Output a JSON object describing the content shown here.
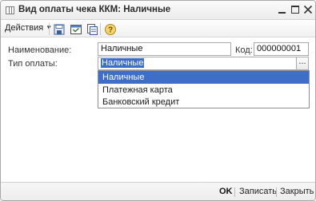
{
  "window": {
    "title": "Вид оплаты чека ККМ: Наличные"
  },
  "toolbar": {
    "actions_label": "Действия",
    "icons": [
      "save-icon",
      "save-and-close-icon",
      "copy-document-icon",
      "help-icon"
    ]
  },
  "form": {
    "name_label": "Наименование:",
    "name_value": "Наличные",
    "code_label": "Код:",
    "code_value": "000000001",
    "payment_type_label": "Тип оплаты:",
    "payment_type_value": "Наличные",
    "select_button": "..."
  },
  "dropdown": {
    "options": [
      "Наличные",
      "Платежная карта",
      "Банковский кредит"
    ],
    "selected_index": 0
  },
  "footer": {
    "ok_label": "OK",
    "save_label": "Записать",
    "close_label": "Закрыть"
  },
  "colors": {
    "selection": "#3f6ec9"
  }
}
